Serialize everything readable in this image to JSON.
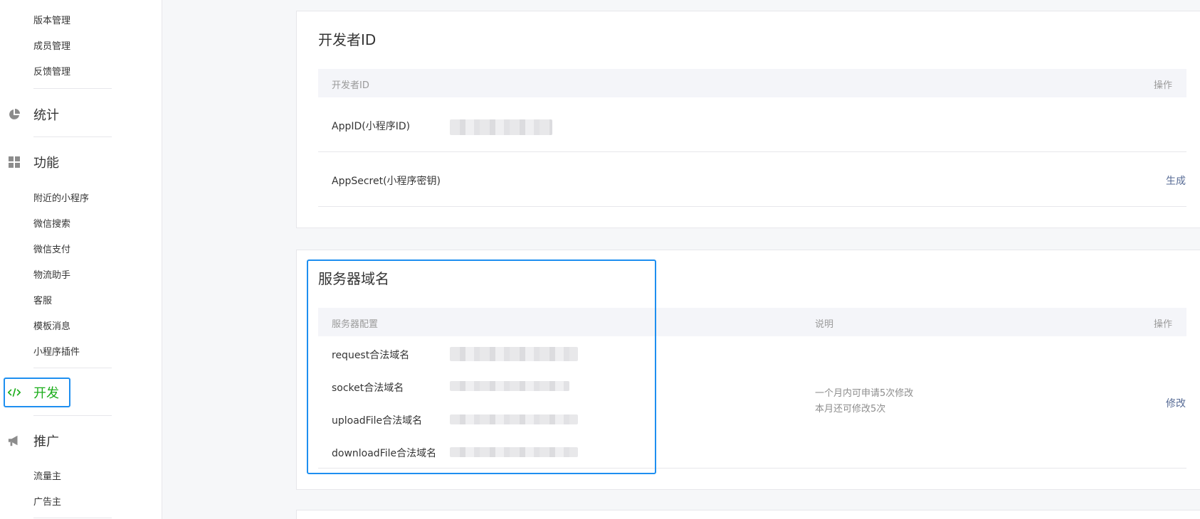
{
  "sidebar": {
    "top_items": [
      "版本管理",
      "成员管理",
      "反馈管理"
    ],
    "stats_label": "统计",
    "features_label": "功能",
    "feature_items": [
      "附近的小程序",
      "微信搜索",
      "微信支付",
      "物流助手",
      "客服",
      "模板消息",
      "小程序插件"
    ],
    "develop_label": "开发",
    "promote_label": "推广",
    "promote_items": [
      "流量主",
      "广告主"
    ],
    "accent_color": "#1aad19"
  },
  "developer_id_card": {
    "title": "开发者ID",
    "header_left": "开发者ID",
    "header_right": "操作",
    "rows": [
      {
        "label": "AppID(小程序ID)",
        "action": ""
      },
      {
        "label": "AppSecret(小程序密钥)",
        "action": "生成"
      }
    ]
  },
  "server_domain_card": {
    "title": "服务器域名",
    "header_config": "服务器配置",
    "header_desc": "说明",
    "header_action": "操作",
    "rows": [
      "request合法域名",
      "socket合法域名",
      "uploadFile合法域名",
      "downloadFile合法域名"
    ],
    "desc_line1": "一个月内可申请5次修改",
    "desc_line2": "本月还可修改5次",
    "action": "修改",
    "highlight_color": "#1e8ff0",
    "link_color": "#576b95"
  }
}
